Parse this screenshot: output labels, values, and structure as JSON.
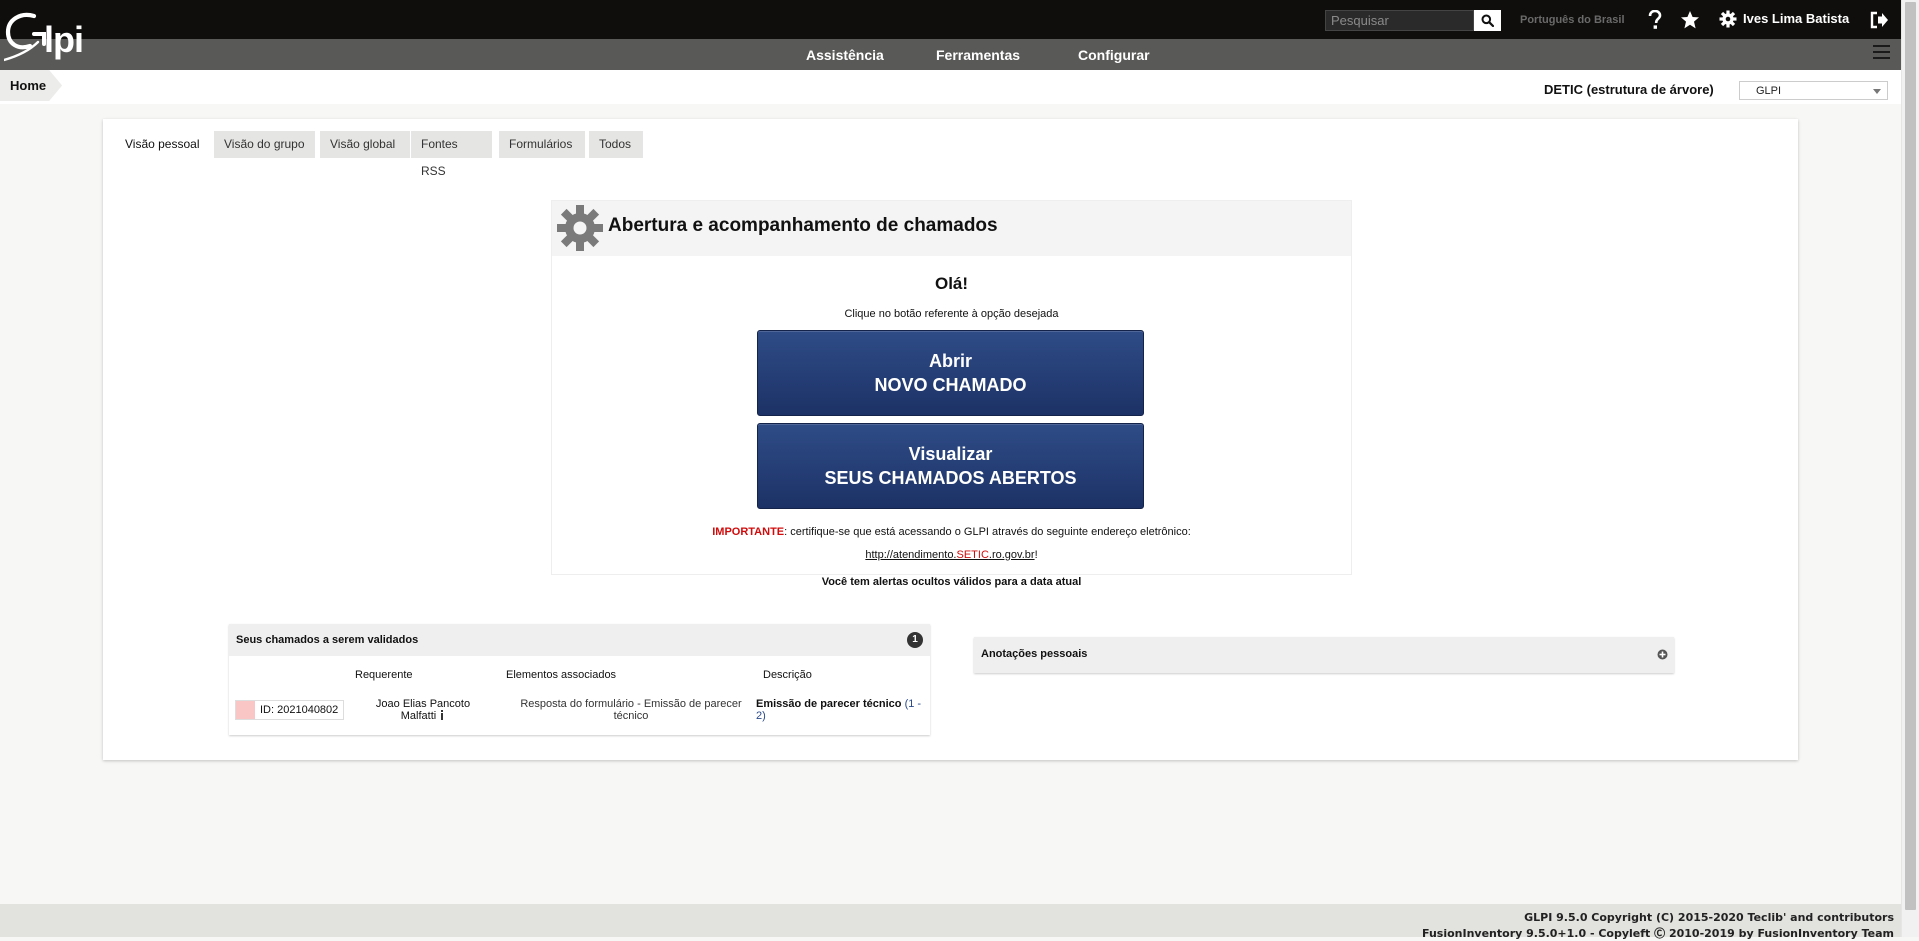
{
  "header": {
    "logo_text": "Glpi",
    "search": {
      "placeholder": "Pesquisar",
      "value": ""
    },
    "language": "Português do Brasil",
    "user_name": "Ives Lima Batista",
    "icons": [
      "help-icon",
      "star-icon",
      "gear-icon",
      "logout-icon",
      "search-icon"
    ]
  },
  "menu": {
    "items": [
      {
        "label": "Assistência"
      },
      {
        "label": "Ferramentas"
      },
      {
        "label": "Configurar"
      }
    ]
  },
  "breadcrumb": {
    "home": "Home"
  },
  "entity": {
    "label": "DETIC (estrutura de árvore)",
    "selected": "GLPI"
  },
  "tabs": [
    {
      "label": "Visão pessoal",
      "active": true
    },
    {
      "label": "Visão do grupo"
    },
    {
      "label": "Visão global"
    },
    {
      "label": "Fontes RSS"
    },
    {
      "label": "Formulários"
    },
    {
      "label": "Todos"
    }
  ],
  "widget": {
    "title": "Abertura e acompanhamento de chamados",
    "greeting": "Olá!",
    "instruction": "Clique no botão referente à opção desejada",
    "button_new": {
      "line1": "Abrir",
      "line2": "NOVO CHAMADO"
    },
    "button_view": {
      "line1": "Visualizar",
      "line2": "SEUS CHAMADOS ABERTOS"
    },
    "notice_label": "IMPORTANTE",
    "notice_text": ": certifique-se que está acessando o GLPI através do seguinte endereço eletrônico:",
    "url_pre": "http://atendimento.",
    "url_red": "SETIC",
    "url_post": ".ro.gov.br",
    "url_suffix": "!"
  },
  "alerts_text": "Você tem alertas ocultos válidos para a data atual",
  "validation": {
    "title": "Seus chamados a serem validados",
    "count": "1",
    "columns": [
      "Requerente",
      "Elementos associados",
      "Descrição"
    ],
    "rows": [
      {
        "id": "ID: 2021040802",
        "requester": "Joao Elias Pancoto Malfatti",
        "associated": "Resposta do formulário - Emissão de parecer técnico",
        "description": "Emissão de parecer técnico",
        "description_count": "(1 - 2)"
      }
    ]
  },
  "notes": {
    "title": "Anotações pessoais"
  },
  "footer": {
    "line1": "GLPI 9.5.0 Copyright (C) 2015-2020 Teclib' and contributors",
    "line2": "FusionInventory 9.5.0+1.0 - Copyleft Ⓒ 2010-2019 by FusionInventory Team"
  },
  "colors": {
    "topbar": "#0f0e0c",
    "menubar": "#595957",
    "button_blue": "#1c3266",
    "important_red": "#d10b0b"
  }
}
